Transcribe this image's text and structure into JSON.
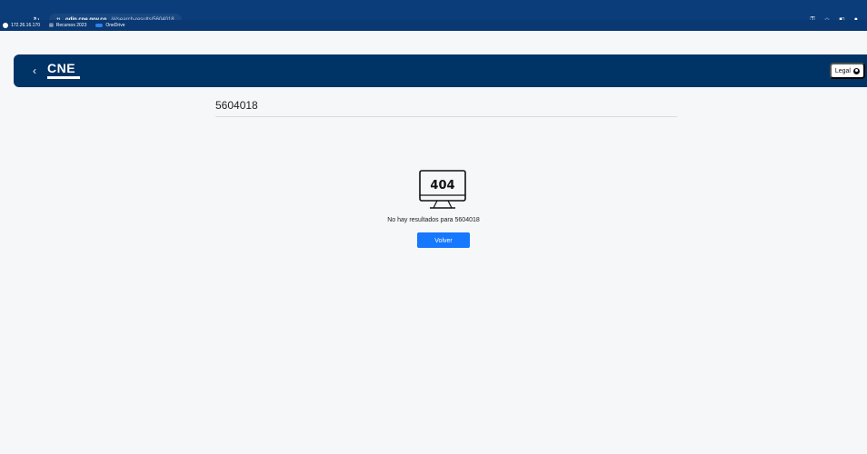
{
  "browser": {
    "url_domain": "odin.cne.gov.co",
    "url_path": "/#/search-results/5604018",
    "bookmarks": [
      {
        "label": "172.26.16.170",
        "icon": "globe-icon"
      },
      {
        "label": "Recursos 2023",
        "icon": "folder-icon"
      },
      {
        "label": "OneDrive",
        "icon": "cloud-icon"
      }
    ]
  },
  "header": {
    "logo_text": "CNE",
    "legal_label": "Legal"
  },
  "search": {
    "value": "5604018"
  },
  "result": {
    "code": "404",
    "message": "No hay resultados para 5604018",
    "button_label": "Volver"
  },
  "colors": {
    "header_bg": "#003366",
    "button_bg": "#1677ff",
    "page_bg": "#f6f7f9",
    "browser_bar": "#0b3d7a"
  }
}
